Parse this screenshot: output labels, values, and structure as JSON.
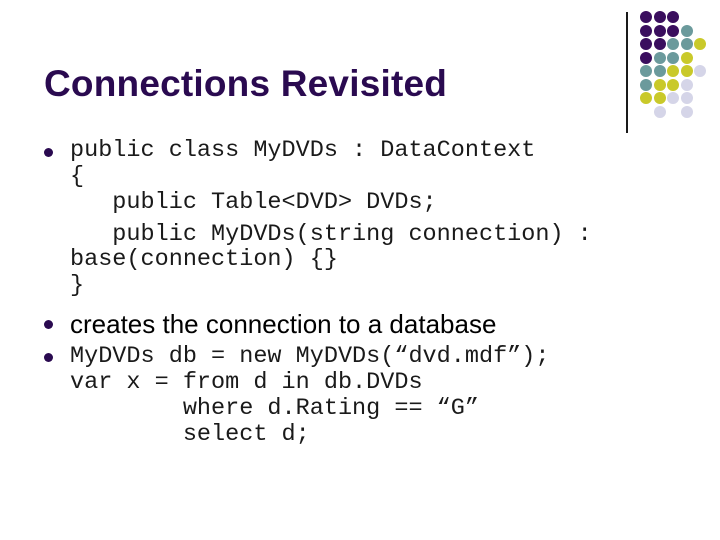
{
  "slide": {
    "title": "Connections Revisited",
    "bullets": [
      {
        "type": "code",
        "lines": [
          "public class MyDVDs : DataContext",
          "{",
          "   public Table<DVD> DVDs;",
          "   public MyDVDs(string connection) :",
          "base(connection) {}",
          "}"
        ]
      },
      {
        "type": "text",
        "text": "creates the connection to a database"
      },
      {
        "type": "code",
        "lines": [
          "MyDVDs db = new MyDVDs(“dvd.mdf”);",
          "var x = from d in db.DVDs",
          "        where d.Rating == “G”",
          "        select d;"
        ]
      }
    ]
  },
  "decoration": {
    "colors": {
      "purple": "#3a0e5e",
      "teal": "#6b9a9c",
      "yellow": "#c9c92a",
      "lavender": "#d5d5e8",
      "bullet": "#2a0a50",
      "title": "#2a0a50"
    },
    "dot_grid": [
      [
        "purple",
        "purple",
        "purple",
        null,
        null
      ],
      [
        "purple",
        "purple",
        "purple",
        "teal",
        null
      ],
      [
        "purple",
        "purple",
        "teal",
        "teal",
        "yellow"
      ],
      [
        "purple",
        "teal",
        "teal",
        "yellow",
        null
      ],
      [
        "teal",
        "teal",
        "yellow",
        "yellow",
        "lavender"
      ],
      [
        "teal",
        "yellow",
        "yellow",
        "lavender",
        null
      ],
      [
        "yellow",
        "yellow",
        "lavender",
        "lavender",
        null
      ],
      [
        null,
        "lavender",
        null,
        "lavender",
        null
      ]
    ]
  }
}
